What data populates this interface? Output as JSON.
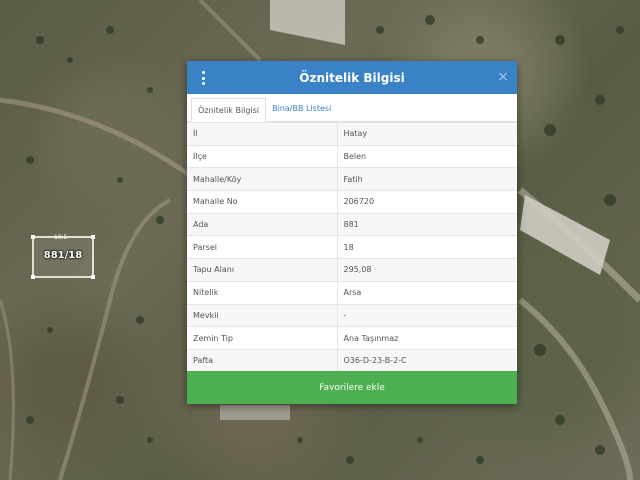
{
  "map": {
    "parcel_label": "881/18",
    "parcel_dim": "10.5"
  },
  "dialog": {
    "title": "Öznitelik Bilgisi",
    "close_glyph": "×",
    "tabs": [
      {
        "label": "Öznitelik Bilgisi",
        "active": true
      },
      {
        "label": "Bina/BB Listesi",
        "active": false
      }
    ],
    "rows": [
      {
        "key": "İl",
        "value": "Hatay"
      },
      {
        "key": "İlçe",
        "value": "Belen"
      },
      {
        "key": "Mahalle/Köy",
        "value": "Fatih"
      },
      {
        "key": "Mahalle No",
        "value": "206720"
      },
      {
        "key": "Ada",
        "value": "881"
      },
      {
        "key": "Parsel",
        "value": "18"
      },
      {
        "key": "Tapu Alanı",
        "value": "295,08"
      },
      {
        "key": "Nitelik",
        "value": "Arsa"
      },
      {
        "key": "Mevkii",
        "value": "-"
      },
      {
        "key": "Zemin Tip",
        "value": "Ana Taşınmaz"
      },
      {
        "key": "Pafta",
        "value": "O36-D-23-B-2-C"
      }
    ],
    "favorite_label": "Favorilere ekle"
  },
  "colors": {
    "header": "#3a82c6",
    "button": "#4caf50"
  }
}
